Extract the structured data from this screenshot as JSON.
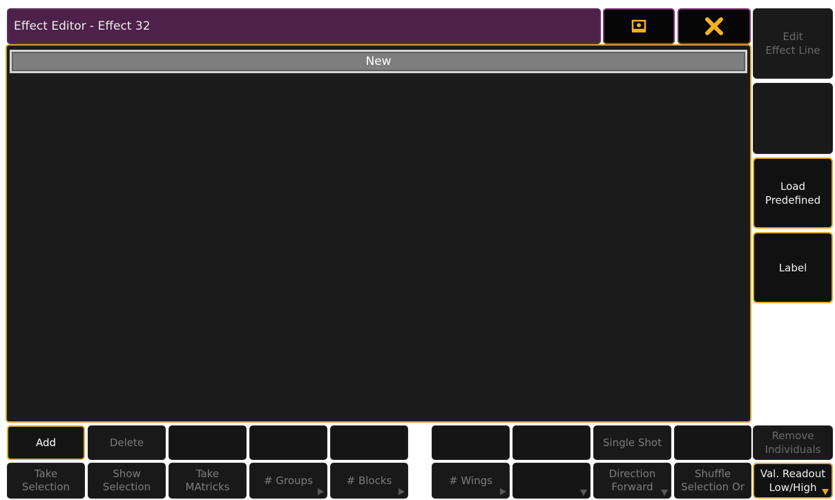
{
  "window": {
    "title": "Effect Editor - Effect 32"
  },
  "editor": {
    "new_row_label": "New"
  },
  "icons": {
    "view": "screen-icon",
    "close": "close-x-icon"
  },
  "colors": {
    "title_bg": "#4d2149",
    "accent": "#e0a92a",
    "panel_bg": "#1c1c1c",
    "close_icon": "#f5b21f"
  },
  "side": {
    "edit_effect_line": "Edit\nEffect Line",
    "empty": "",
    "load_predefined": "Load\nPredefined",
    "label": "Label",
    "remove_individuals": "Remove\nIndividuals",
    "val_readout": "Val. Readout\nLow/High"
  },
  "bottom_row1": {
    "add": "Add",
    "delete": "Delete",
    "single_shot": "Single Shot"
  },
  "bottom_row2": {
    "take_selection": "Take\nSelection",
    "show_selection": "Show\nSelection",
    "take_matricks": "Take\nMAtricks",
    "groups": "# Groups",
    "blocks": "# Blocks",
    "wings": "# Wings",
    "direction": "Direction\nForward",
    "shuffle": "Shuffle\nSelection Or"
  }
}
